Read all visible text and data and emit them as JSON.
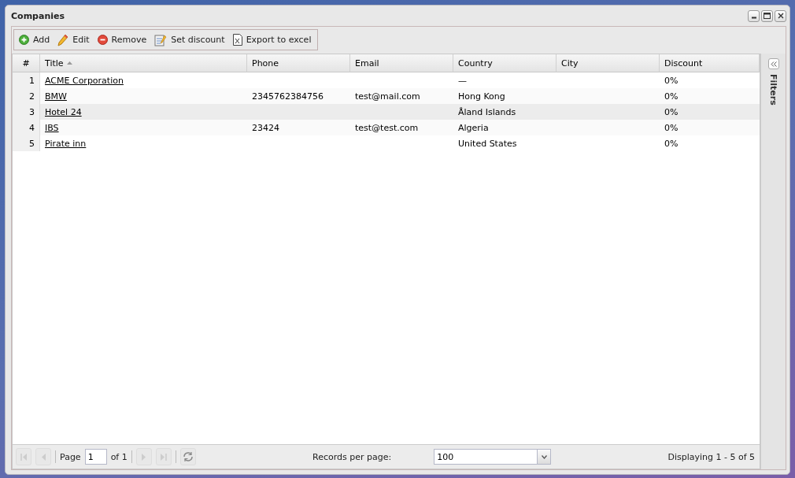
{
  "window": {
    "title": "Companies"
  },
  "toolbar": [
    {
      "kind": "add",
      "label": "Add"
    },
    {
      "kind": "edit",
      "label": "Edit"
    },
    {
      "kind": "remove",
      "label": "Remove"
    },
    {
      "kind": "discount",
      "label": "Set discount"
    },
    {
      "kind": "excel",
      "label": "Export to excel"
    }
  ],
  "table": {
    "columns": [
      {
        "label": "#",
        "sorted": false
      },
      {
        "label": "Title",
        "sorted": true
      },
      {
        "label": "Phone",
        "sorted": false
      },
      {
        "label": "Email",
        "sorted": false
      },
      {
        "label": "Country",
        "sorted": false
      },
      {
        "label": "City",
        "sorted": false
      },
      {
        "label": "Discount",
        "sorted": false
      }
    ],
    "rows": [
      {
        "cells": [
          "1",
          "ACME Corporation",
          "",
          "",
          "—",
          "",
          "0%"
        ],
        "selected": false
      },
      {
        "cells": [
          "2",
          "BMW",
          "2345762384756",
          "test@mail.com",
          "Hong Kong",
          "",
          "0%"
        ],
        "selected": false
      },
      {
        "cells": [
          "3",
          "Hotel 24",
          "",
          "",
          "Åland Islands",
          "",
          "0%"
        ],
        "selected": true
      },
      {
        "cells": [
          "4",
          "IBS",
          "23424",
          "test@test.com",
          "Algeria",
          "",
          "0%"
        ],
        "selected": false
      },
      {
        "cells": [
          "5",
          "Pirate inn",
          "",
          "",
          "United States",
          "",
          "0%"
        ],
        "selected": false
      }
    ]
  },
  "filters_panel": {
    "label": "Filters"
  },
  "paging": {
    "page_label": "Page",
    "page": "1",
    "of_label": "of 1",
    "per_page_label": "Records per page:",
    "per_page": "100",
    "display": "Displaying 1 - 5 of 5"
  }
}
